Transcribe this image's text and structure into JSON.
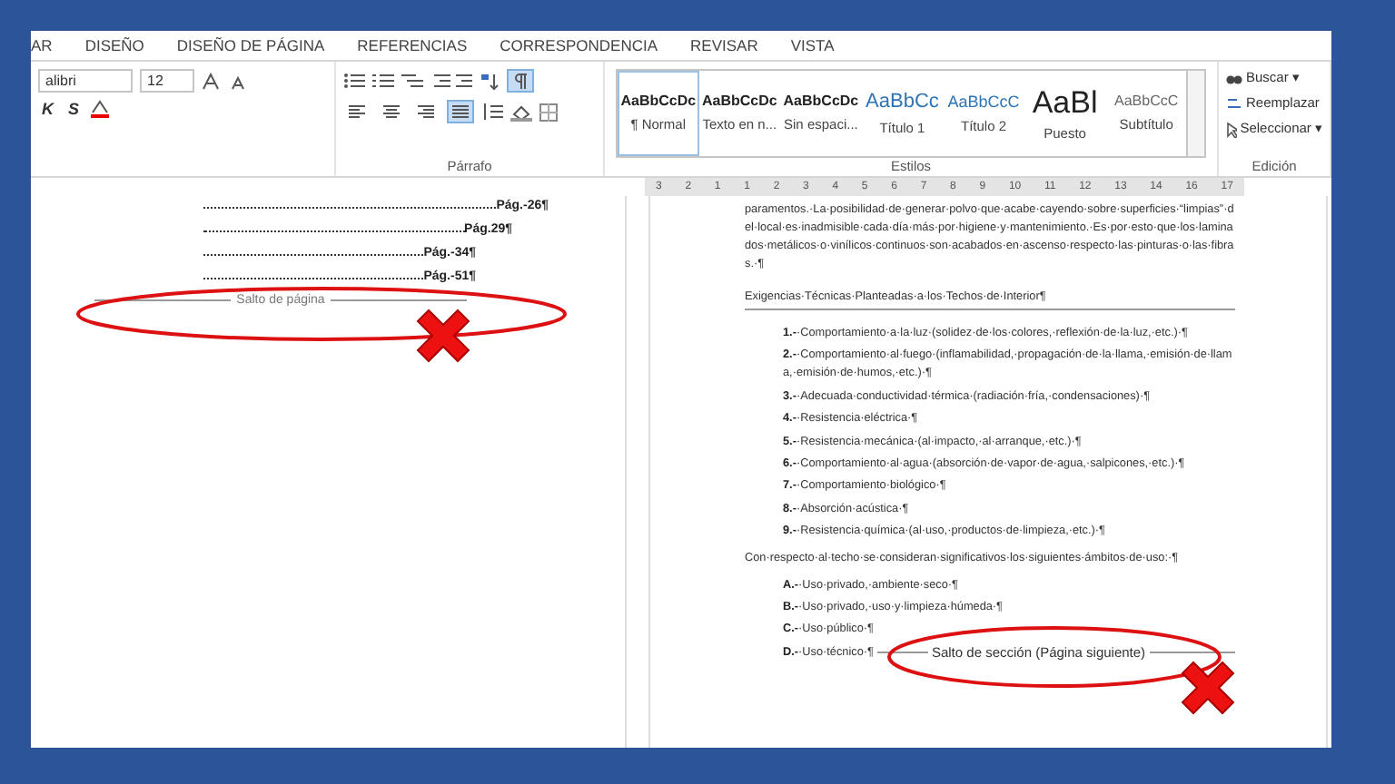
{
  "menu_tabs": [
    "AR",
    "DISEÑO",
    "DISEÑO DE PÁGINA",
    "REFERENCIAS",
    "CORRESPONDENCIA",
    "REVISAR",
    "VISTA"
  ],
  "font_group": {
    "font_name": "alibri",
    "font_size": "12",
    "format_buttons": [
      "K",
      "S"
    ]
  },
  "paragraph_group": {
    "label": "Párrafo",
    "show_marks_on": true,
    "alignments": [
      {
        "selected": false
      },
      {
        "selected": false
      },
      {
        "selected": false
      },
      {
        "selected": true
      }
    ]
  },
  "styles_group": {
    "label": "Estilos",
    "styles": [
      {
        "preview": "AaBbCcDc",
        "name": "¶ Normal",
        "kind": "body",
        "selected": true
      },
      {
        "preview": "AaBbCcDc",
        "name": "Texto en n...",
        "kind": "body",
        "selected": false
      },
      {
        "preview": "AaBbCcDc",
        "name": "Sin espaci...",
        "kind": "body",
        "selected": false
      },
      {
        "preview": "AaBbCc",
        "name": "Título 1",
        "kind": "heading",
        "selected": false
      },
      {
        "preview": "AaBbCcC",
        "name": "Título 2",
        "kind": "subheading",
        "selected": false
      },
      {
        "preview": "AaBl",
        "name": "Puesto",
        "kind": "title",
        "selected": false
      },
      {
        "preview": "AaBbCcC",
        "name": "Subtítulo",
        "kind": "subtitle",
        "selected": false
      }
    ]
  },
  "editing_group": {
    "label": "Edición",
    "items": [
      {
        "label": "Buscar ▾",
        "kind": "find"
      },
      {
        "label": "Reemplazar",
        "kind": "replace"
      },
      {
        "label": "Seleccionar ▾",
        "kind": "select"
      }
    ]
  },
  "ruler": [
    "3",
    "2",
    "1",
    "1",
    "2",
    "3",
    "4",
    "5",
    "6",
    "7",
    "8",
    "9",
    "10",
    "11",
    "12",
    "13",
    "14",
    "16",
    "17"
  ],
  "left_page": {
    "toc": [
      "Pág.-26¶",
      "Pág.29¶",
      "Pág.-34¶",
      "Pág.-51¶"
    ],
    "page_break": "Salto de página"
  },
  "right_page": {
    "intro": "paramentos.·La·posibilidad·de·generar·polvo·que·acabe·cayendo·sobre·superficies·“limpias”·del·local·es·inadmisible·cada·día·más·por·higiene·y·mantenimiento.·Es·por·esto·que·los·laminados·metálicos·o·vinílicos·continuos·son·acabados·en·ascenso·respecto·las·pinturas·o·las·fibras.·¶",
    "heading": "Exigencias·Técnicas·Planteadas·a·los·Techos·de·Interior¶",
    "requirements": [
      {
        "marker": "1.-",
        "text": "·Comportamiento·a·la·luz·(solidez·de·los·colores,·reflexión·de·la·luz,·etc.)·¶"
      },
      {
        "marker": "2.-",
        "text": "·Comportamiento·al·fuego·(inflamabilidad,·propagación·de·la·llama,·emisión·de·llama,·emisión·de·humos,·etc.)·¶"
      },
      {
        "marker": "3.-",
        "text": "·Adecuada·conductividad·térmica·(radiación·fría,·condensaciones)·¶"
      },
      {
        "marker": "4.-",
        "text": "·Resistencia·eléctrica·¶"
      },
      {
        "marker": "5.-",
        "text": "·Resistencia·mecánica·(al·impacto,·al·arranque,·etc.)·¶"
      },
      {
        "marker": "6.-",
        "text": "·Comportamiento·al·agua·(absorción·de·vapor·de·agua,·salpicones,·etc.)·¶"
      },
      {
        "marker": "7.-",
        "text": "·Comportamiento·biológico·¶"
      },
      {
        "marker": "8.-",
        "text": "·Absorción·acústica·¶"
      },
      {
        "marker": "9.-",
        "text": "·Resistencia·química·(al·uso,·productos·de·limpieza,·etc.)·¶"
      }
    ],
    "uses_intro": "Con·respecto·al·techo·se·consideran·significativos·los·siguientes·ámbitos·de·uso:·¶",
    "uses": [
      {
        "marker": "A.-",
        "text": "·Uso·privado,·ambiente·seco·¶"
      },
      {
        "marker": "B.-",
        "text": "·Uso·privado,·uso·y·limpieza·húmeda·¶"
      },
      {
        "marker": "C.-",
        "text": "·Uso·público·¶"
      },
      {
        "marker": "D.-",
        "text": "·Uso·técnico·¶"
      }
    ],
    "section_break": "Salto de sección (Página siguiente)"
  }
}
